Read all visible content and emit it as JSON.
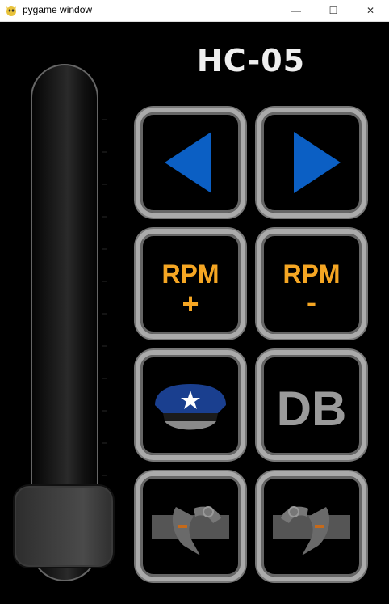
{
  "window": {
    "title": "pygame window",
    "controls": {
      "minimize": "—",
      "maximize": "☐",
      "close": "✕"
    }
  },
  "header": {
    "title": "HC-05"
  },
  "colors": {
    "arrow_blue": "#0b5fc4",
    "rpm_orange": "#f5a623",
    "db_gray": "#9a9a9a",
    "button_border": "#aaaaaa"
  },
  "buttons": {
    "left": {
      "icon": "left-arrow-icon"
    },
    "right": {
      "icon": "right-arrow-icon"
    },
    "rpm_up": {
      "label": "RPM",
      "sign": "+"
    },
    "rpm_down": {
      "label": "RPM",
      "sign": "-"
    },
    "police": {
      "icon": "police-cap-icon"
    },
    "db": {
      "label": "DB"
    },
    "signal_left": {
      "icon": "left-turn-signal-icon"
    },
    "signal_right": {
      "icon": "right-turn-signal-icon"
    }
  },
  "throttle": {
    "icon": "throttle-slider",
    "level": 0.0
  }
}
